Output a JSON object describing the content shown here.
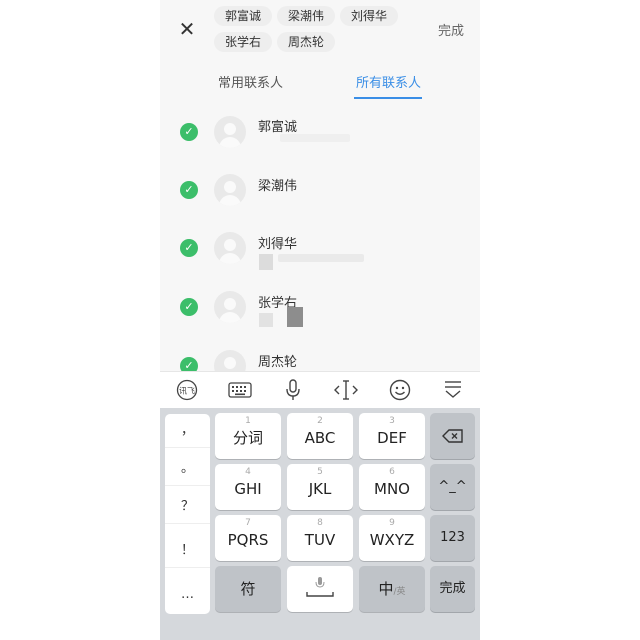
{
  "header": {
    "close_icon": "close-icon",
    "selected": [
      "郭富诚",
      "梁潮伟",
      "刘得华",
      "张学右",
      "周杰轮"
    ],
    "done_label": "完成"
  },
  "tabs": [
    {
      "label": "常用联系人",
      "active": false
    },
    {
      "label": "所有联系人",
      "active": true
    }
  ],
  "contacts": [
    {
      "name": "郭富诚",
      "checked": true
    },
    {
      "name": "梁潮伟",
      "checked": true
    },
    {
      "name": "刘得华",
      "checked": true
    },
    {
      "name": "张学右",
      "checked": true
    },
    {
      "name": "周杰轮",
      "checked": true
    }
  ],
  "toolbar": {
    "icons": [
      "xunfei-logo-icon",
      "keyboard-icon",
      "microphone-icon",
      "text-cursor-icon",
      "emoji-icon",
      "collapse-keyboard-icon"
    ],
    "logo_text": "讯飞"
  },
  "keyboard": {
    "punctuation": [
      "，",
      "。",
      "？",
      "！",
      "…"
    ],
    "keys": [
      {
        "num": "1",
        "label": "分词"
      },
      {
        "num": "2",
        "label": "ABC"
      },
      {
        "num": "3",
        "label": "DEF"
      },
      {
        "num": "4",
        "label": "GHI"
      },
      {
        "num": "5",
        "label": "JKL"
      },
      {
        "num": "6",
        "label": "MNO"
      },
      {
        "num": "7",
        "label": "PQRS"
      },
      {
        "num": "8",
        "label": "TUV"
      },
      {
        "num": "9",
        "label": "WXYZ"
      }
    ],
    "backspace_icon": "backspace-icon",
    "emoticon_label": "^_^",
    "numbers_label": "123",
    "symbol_label": "符",
    "space_icon": "space-microphone-icon",
    "lang_label": "中",
    "lang_sub_label": "/英",
    "done_label": "完成"
  },
  "colors": {
    "accent": "#3a8ee6",
    "check_green": "#3cbe6a",
    "keyboard_bg": "#d5d8dc"
  }
}
